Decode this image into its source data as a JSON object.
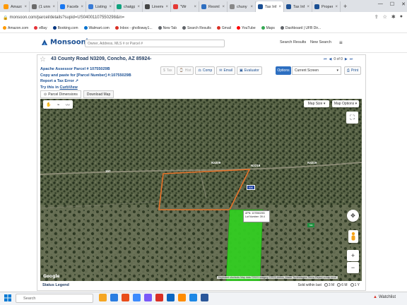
{
  "browser": {
    "tabs": [
      {
        "label": "Amazon",
        "color": "#ff9900"
      },
      {
        "label": "(1 unread",
        "color": "#6b6b6b"
      },
      {
        "label": "Facebook",
        "color": "#1877f2"
      },
      {
        "label": "Listing",
        "color": "#3a7bd5"
      },
      {
        "label": "chatgpt",
        "color": "#10a37f"
      },
      {
        "label": "Linemen",
        "color": "#444444"
      },
      {
        "label": "\"Wr",
        "color": "#e53935"
      },
      {
        "label": "Resmls",
        "color": "#2d6fc1"
      },
      {
        "label": "chuny",
        "color": "#888888"
      },
      {
        "label": "Tax Info",
        "color": "#1a4f93",
        "active": true
      },
      {
        "label": "Tax Info",
        "color": "#1a4f93"
      },
      {
        "label": "Property",
        "color": "#1a4f93"
      }
    ],
    "url": "monsoon.com/parcel/details?supid=US04001107550298&in=",
    "bookmarks": [
      {
        "label": "Amazon.com",
        "color": "#ff9900"
      },
      {
        "label": "eBay",
        "color": "#e53238"
      },
      {
        "label": "Booking.com",
        "color": "#003580"
      },
      {
        "label": "Walmart.com",
        "color": "#0071ce"
      },
      {
        "label": "Inbox - gholloway1...",
        "color": "#d93025"
      },
      {
        "label": "New Tab",
        "color": "#5f6368"
      },
      {
        "label": "Search Results",
        "color": "#5f6368"
      },
      {
        "label": "Gmail",
        "color": "#d93025"
      },
      {
        "label": "YouTube",
        "color": "#ff0000"
      },
      {
        "label": "Maps",
        "color": "#34a853"
      },
      {
        "label": "Dashboard | UFB Dir...",
        "color": "#5f6368"
      }
    ]
  },
  "header": {
    "logo_text": "Monsoon",
    "logo_sup": "°",
    "search_placeholder": "Owner, Address, MLS # or Parcel #",
    "search_results_label": "Search Results",
    "new_search_label": "New Search",
    "menu_icon": "≡"
  },
  "property": {
    "title": "43 County Road N3209, Concho, AZ 85924-",
    "pager": {
      "count": "0 of 0"
    },
    "assessor_line": "Apache Assessor Parcel # 10755029B",
    "copy_line": "Copy and paste for [Parcel Number] #:10755029B",
    "report_line": "Report a Tax Error",
    "curbview_prefix": "Try this in",
    "curbview_link": "CurbView",
    "actions": [
      {
        "label": "Tax",
        "disabled": true
      },
      {
        "label": "Hist",
        "disabled": true
      },
      {
        "label": "Comp",
        "disabled": false
      },
      {
        "label": "Email",
        "disabled": false
      },
      {
        "label": "Evaluator",
        "disabled": false
      }
    ],
    "options_label": "Options",
    "screen_select_value": "Current Screen",
    "print_label": "Print",
    "tabs": [
      {
        "label": "Parcel Dimensions",
        "active": true
      },
      {
        "label": "Download Map",
        "active": false
      }
    ]
  },
  "map": {
    "map_size_label": "Map Size",
    "map_options_label": "Map Options",
    "google_label": "Google",
    "attribution": "Keyboard shortcuts   Map data ©2023 Imagery ©2023 Airbus, Maxar Technologies   Terms   Report a map error",
    "road_labels": {
      "n3209_a": "N3209",
      "n3209_b": "N3219",
      "n3219": "N3219",
      "left": "157"
    },
    "shield_ne": "90K",
    "shield_se": "70K",
    "tooltip": {
      "line1": "APN: 10755029D",
      "line2": "Lot Number: 39.4"
    },
    "colors": {
      "parcel_outline": "#e8732a",
      "sold_fill": "#33cc22",
      "shield_blue": "#1d3f9c"
    }
  },
  "status": {
    "legend_label": "Status Legend",
    "sold_within_label": "Sold within last",
    "options": [
      {
        "label": "3 M",
        "selected": false
      },
      {
        "label": "6 M",
        "selected": false
      },
      {
        "label": "1 Y",
        "selected": false
      }
    ]
  },
  "taskbar": {
    "search_placeholder": "Search",
    "apps": [
      "#f5a623",
      "#2a7de1",
      "#e94e1b",
      "#3d8bfd",
      "#7a5af8",
      "#d93025",
      "#0a66c2",
      "#ff8c00",
      "#1e88e5",
      "#2b579a"
    ],
    "watchlist_label": "Watchlist"
  }
}
